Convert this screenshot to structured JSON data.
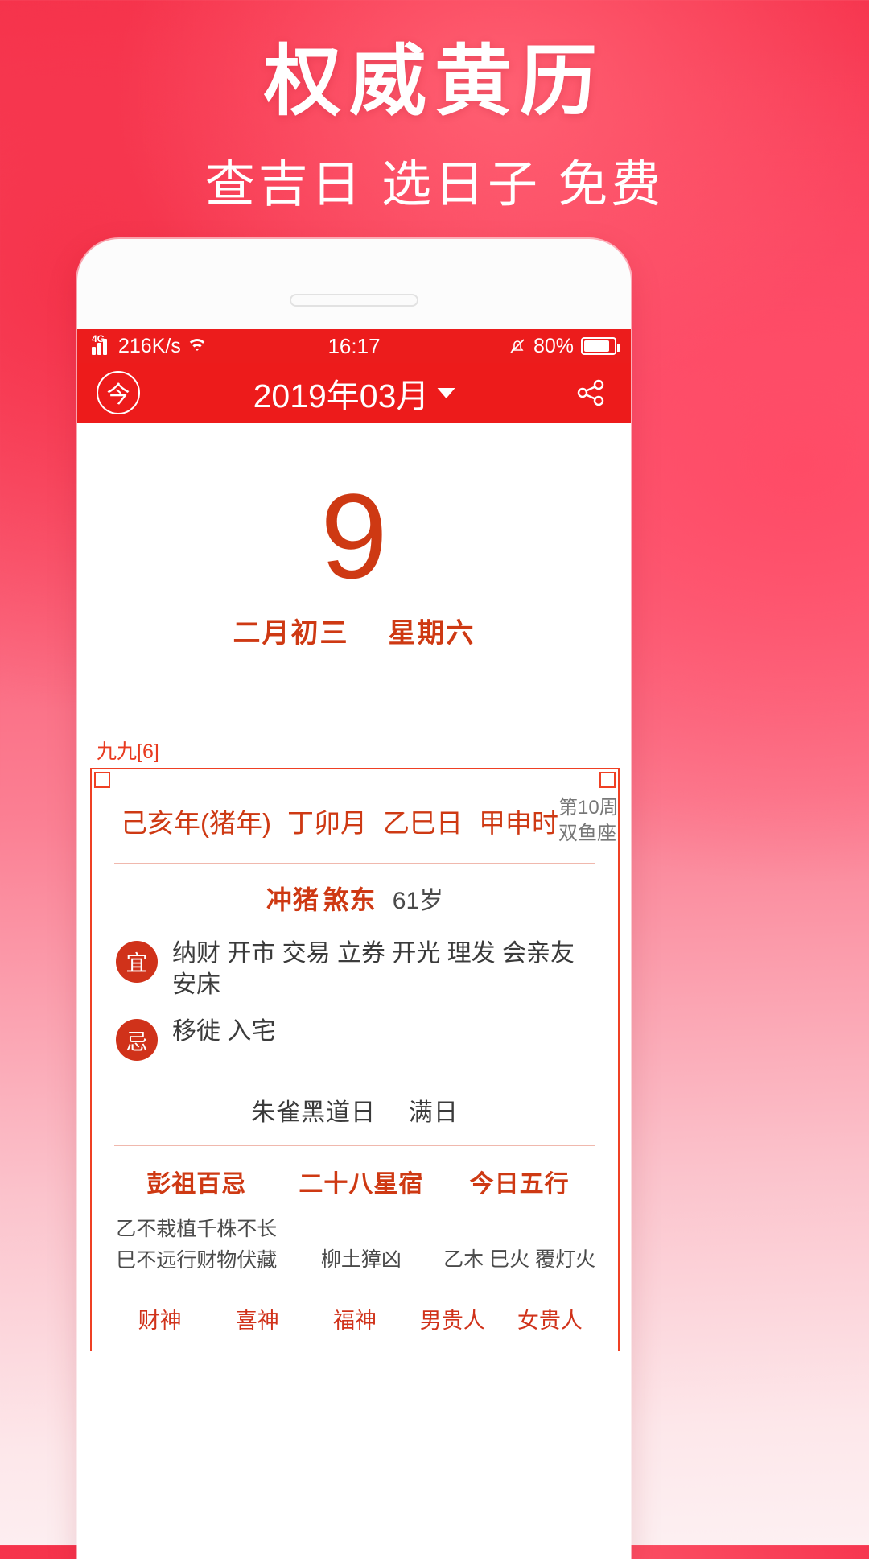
{
  "promo": {
    "title": "权威黄历",
    "subtitle": "查吉日 选日子 免费"
  },
  "status_bar": {
    "network_type": "4G",
    "speed": "216K/s",
    "wifi_icon": "wifi-icon",
    "time": "16:17",
    "mute_icon": "mute-bell-icon",
    "battery_percent": "80%"
  },
  "navbar": {
    "today_button": "今",
    "title": "2019年03月",
    "caret_icon": "chevron-down-icon",
    "share_icon": "share-icon"
  },
  "date": {
    "day": "9",
    "lunar": "二月初三",
    "weekday": "星期六"
  },
  "card": {
    "jiujiu_label": "九九[6]",
    "ganzhi": [
      "己亥年(猪年)",
      "丁卯月",
      "乙巳日",
      "甲申时"
    ],
    "week_of_year": "第10周",
    "zodiac": "双鱼座",
    "chong": "冲猪",
    "sha": "煞东",
    "age": "61岁",
    "yi_badge": "宜",
    "yi_text": "纳财 开市 交易 立券 开光 理发 会亲友 安床",
    "ji_badge": "忌",
    "ji_text": "移徙 入宅",
    "huangdao": "朱雀黑道日",
    "shieryi": "满日",
    "columns": [
      {
        "header": "彭祖百忌",
        "lines": [
          "乙不栽植千株不长",
          "巳不远行财物伏藏"
        ]
      },
      {
        "header": "二十八星宿",
        "lines": [
          "柳土獐凶"
        ]
      },
      {
        "header": "今日五行",
        "lines": [
          "乙木 巳火 覆灯火"
        ]
      }
    ],
    "gods": [
      "财神",
      "喜神",
      "福神",
      "男贵人",
      "女贵人"
    ]
  },
  "colors": {
    "brand_red": "#ed1b1b",
    "accent_orange": "#ce3913",
    "frame_red": "#ef4024",
    "badge_red": "#d0321a"
  }
}
